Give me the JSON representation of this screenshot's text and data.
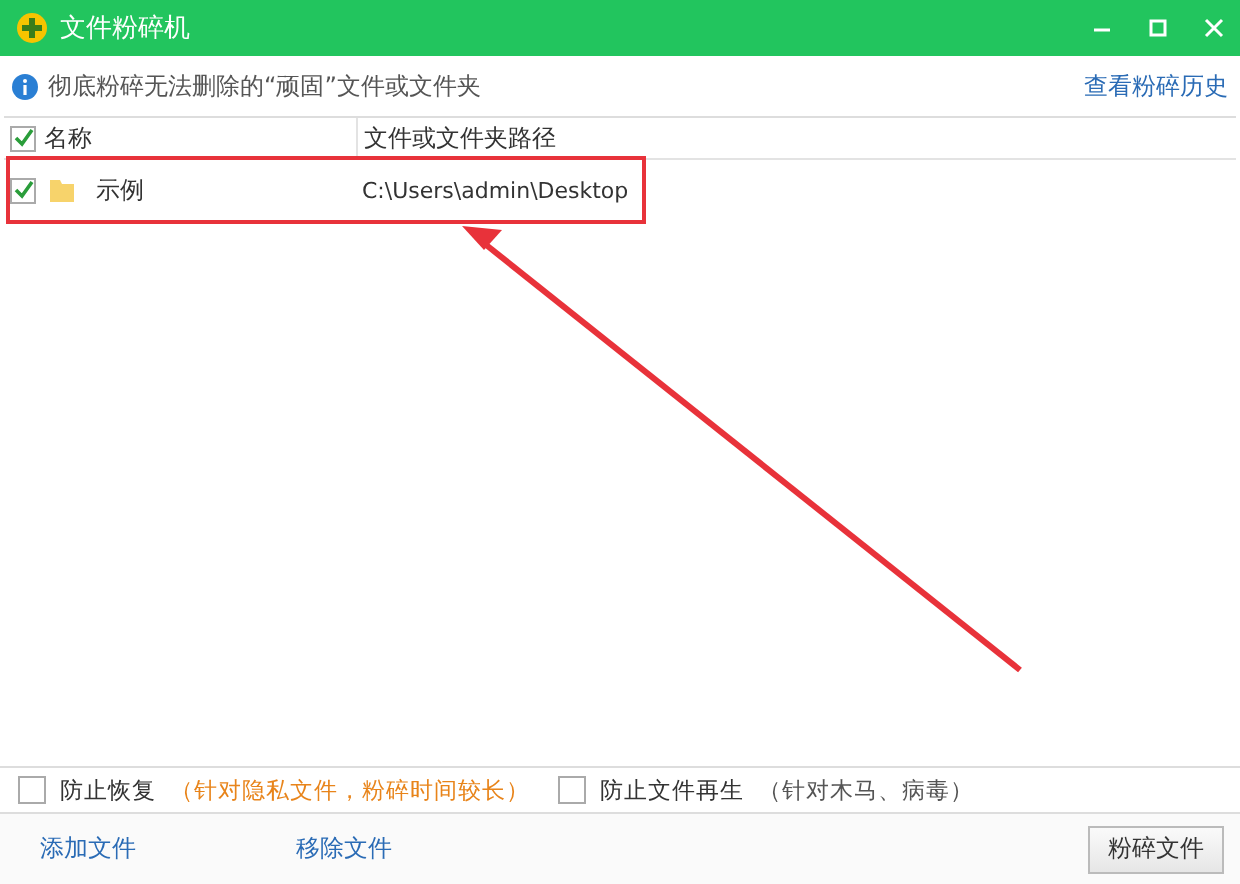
{
  "window": {
    "title": "文件粉碎机"
  },
  "info": {
    "text": "彻底粉碎无法删除的“顽固”文件或文件夹",
    "link": "查看粉碎历史"
  },
  "table": {
    "select_all": {
      "checked": true
    },
    "columns": [
      "名称",
      "文件或文件夹路径"
    ],
    "rows": [
      {
        "name": "示例",
        "path": "C:\\Users\\admin\\Desktop",
        "checked": true
      }
    ]
  },
  "options": [
    {
      "label": "防止恢复",
      "note": "（针对隐私文件，粉碎时间较长）",
      "highlight": true,
      "checked": false
    },
    {
      "label": "防止文件再生",
      "note": "（针对木马、病毒）",
      "highlight": false,
      "checked": false
    }
  ],
  "actions": [
    "添加文件",
    "移除文件"
  ],
  "primary_button": "粉碎文件",
  "annotation": {
    "shown": true
  }
}
